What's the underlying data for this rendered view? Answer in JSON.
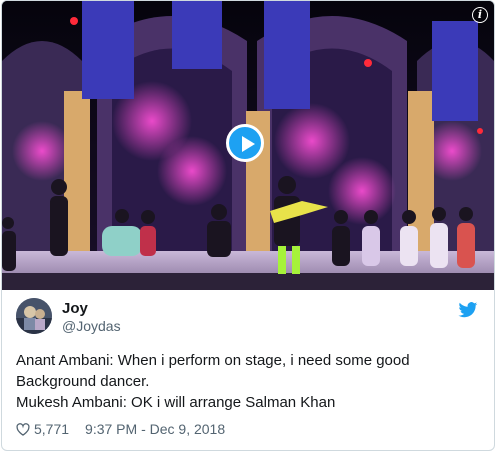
{
  "tweet": {
    "display_name": "Joy",
    "handle": "@Joydas",
    "text_lines": [
      "Anant Ambani: When i perform on stage, i need some good",
      "Background dancer.",
      "Mukesh Ambani: OK i will arrange Salman Khan"
    ],
    "likes": "5,771",
    "timestamp": "9:37 PM - Dec 9, 2018"
  },
  "media": {
    "info_label": "i",
    "play_icon": "play-icon"
  },
  "colors": {
    "twitter_blue": "#1da1f2",
    "text_primary": "#14171a",
    "text_secondary": "#536471",
    "border": "#cfd9de"
  }
}
